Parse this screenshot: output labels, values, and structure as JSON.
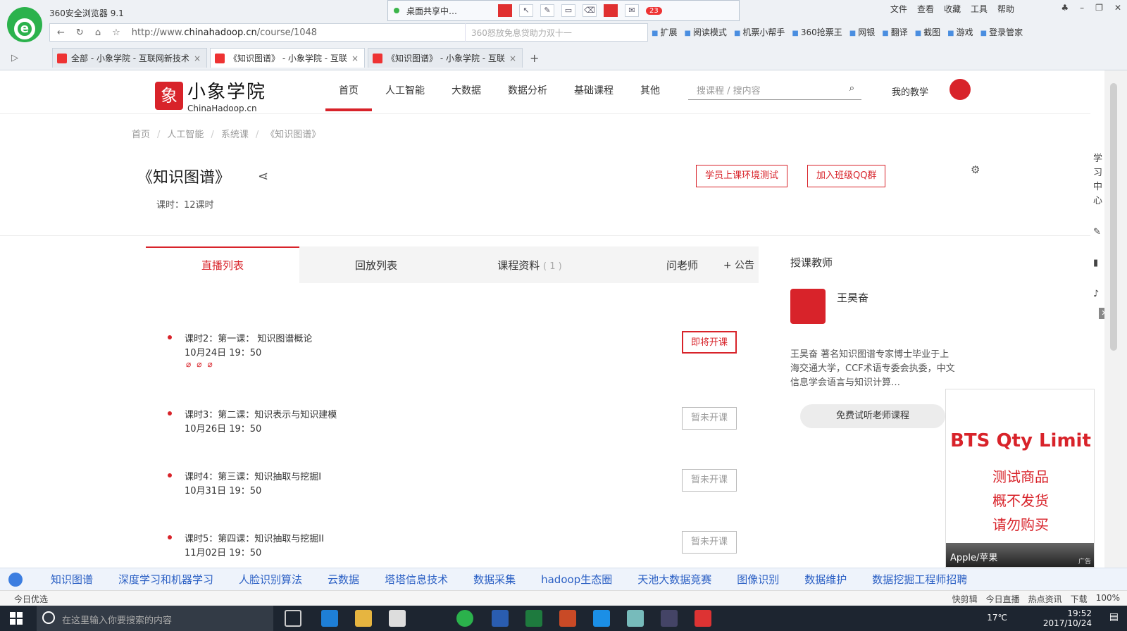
{
  "browser": {
    "app_title": "360安全浏览器 9.1",
    "share_label": "桌面共享中…",
    "share_badge": "23",
    "menu": [
      "文件",
      "查看",
      "收藏",
      "工具",
      "帮助"
    ],
    "url_prefix": "http://www.",
    "url_host": "chinahadoop.cn",
    "url_path": "/course/1048",
    "search_placeholder": "360怒放免息贷助力双十一",
    "extensions": [
      "扩展",
      "阅读模式",
      "机票小帮手",
      "360抢票王",
      "网银",
      "翻译",
      "截图",
      "游戏",
      "登录管家"
    ],
    "tabs": [
      {
        "title": "全部 - 小象学院 - 互联网新技术",
        "active": false
      },
      {
        "title": "《知识图谱》 - 小象学院 - 互联",
        "active": true
      },
      {
        "title": "《知识图谱》 - 小象学院 - 互联",
        "active": false
      }
    ]
  },
  "site": {
    "brand_cn": "小象学院",
    "brand_en": "ChinaHadoop.cn",
    "nav": [
      "首页",
      "人工智能",
      "大数据",
      "数据分析",
      "基础课程",
      "其他"
    ],
    "search_placeholder": "搜课程 / 搜内容",
    "my_teaching": "我的教学"
  },
  "course": {
    "breadcrumb": [
      "首页",
      "人工智能",
      "系统课",
      "《知识图谱》"
    ],
    "title": "《知识图谱》",
    "hours": "课时：12课时",
    "btn_env_test": "学员上课环境测试",
    "btn_join_qq": "加入班级QQ群",
    "tabs": [
      "直播列表",
      "回放列表",
      "课程资料",
      "问老师",
      "+ 公告"
    ],
    "materials_count": "( 1 )",
    "lessons": [
      {
        "name": "课时2：第一课： 知识图谱概论",
        "time": "10月24日 19：50",
        "status": "即将开课",
        "hot": true
      },
      {
        "name": "课时3：第二课：知识表示与知识建模",
        "time": "10月26日 19：50",
        "status": "暂未开课",
        "hot": false
      },
      {
        "name": "课时4：第三课：知识抽取与挖掘I",
        "time": "10月31日 19：50",
        "status": "暂未开课",
        "hot": false
      },
      {
        "name": "课时5：第四课：知识抽取与挖掘II",
        "time": "11月02日 19：50",
        "status": "暂未开课",
        "hot": false
      }
    ]
  },
  "teacher": {
    "heading": "授课教师",
    "name": "王昊奋",
    "desc": "王昊奋  著名知识图谱专家博士毕业于上海交通大学，CCF术语专委会执委，中文信息学会语言与知识计算…",
    "trial_button": "免费试听老师课程",
    "side_label": "学习中心"
  },
  "ad": {
    "title": "BTS Qty Limit",
    "lines": [
      "测试商品",
      "概不发货",
      "请勿购买"
    ],
    "footer": "Apple/苹果",
    "tag": "广告"
  },
  "hotwords": [
    "知识图谱",
    "深度学习和机器学习",
    "人脸识别算法",
    "云数据",
    "塔塔信息技术",
    "数据采集",
    "hadoop生态圈",
    "天池大数据竞赛",
    "图像识别",
    "数据维护",
    "数据挖掘工程师招聘"
  ],
  "statusbar": {
    "left": "今日优选",
    "right": [
      "快剪辑",
      "今日直播",
      "热点资讯",
      "下载",
      "100%"
    ]
  },
  "taskbar": {
    "search_placeholder": "在这里输入你要搜索的内容",
    "temp": "17℃",
    "time": "19:52",
    "date": "2017/10/24"
  }
}
